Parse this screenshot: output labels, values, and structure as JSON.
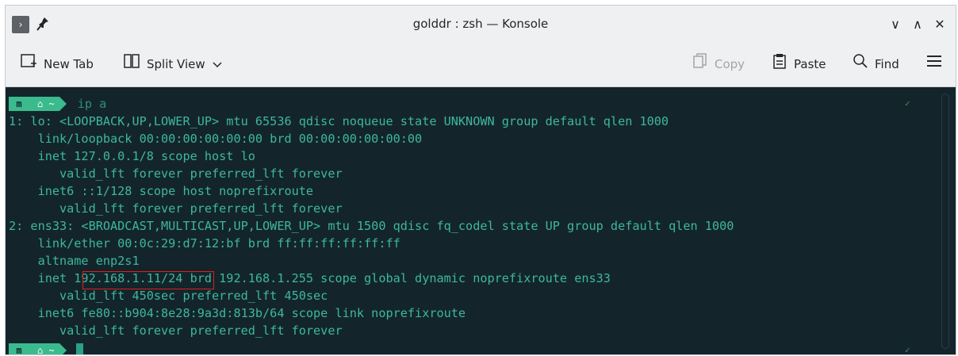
{
  "window": {
    "title": "golddr : zsh — Konsole",
    "app_icon_glyph": "›",
    "controls": {
      "minimize": "∨",
      "maximize": "∧",
      "close": "✕"
    }
  },
  "toolbar": {
    "new_tab": "New Tab",
    "split_view": "Split View",
    "copy": "Copy",
    "paste": "Paste",
    "find": "Find"
  },
  "prompt": {
    "segment_icon": "m",
    "home": "⌂ ~",
    "command": "ip a"
  },
  "output": [
    "1: lo: <LOOPBACK,UP,LOWER_UP> mtu 65536 qdisc noqueue state UNKNOWN group default qlen 1000",
    "    link/loopback 00:00:00:00:00:00 brd 00:00:00:00:00:00",
    "    inet 127.0.0.1/8 scope host lo",
    "       valid_lft forever preferred_lft forever",
    "    inet6 ::1/128 scope host noprefixroute",
    "       valid_lft forever preferred_lft forever",
    "2: ens33: <BROADCAST,MULTICAST,UP,LOWER_UP> mtu 1500 qdisc fq_codel state UP group default qlen 1000",
    "    link/ether 00:0c:29:d7:12:bf brd ff:ff:ff:ff:ff:ff",
    "    altname enp2s1",
    "    inet 192.168.1.11/24 brd 192.168.1.255 scope global dynamic noprefixroute ens33",
    "       valid_lft 450sec preferred_lft 450sec",
    "    inet6 fe80::b904:8e28:9a3d:813b/64 scope link noprefixroute",
    "       valid_lft forever preferred_lft forever"
  ],
  "status_check": "✓",
  "colors": {
    "terminal_bg": "#13252b",
    "terminal_fg": "#3fb6a0",
    "prompt_accent": "#3bba8e",
    "highlight_border": "#e11d1d"
  }
}
